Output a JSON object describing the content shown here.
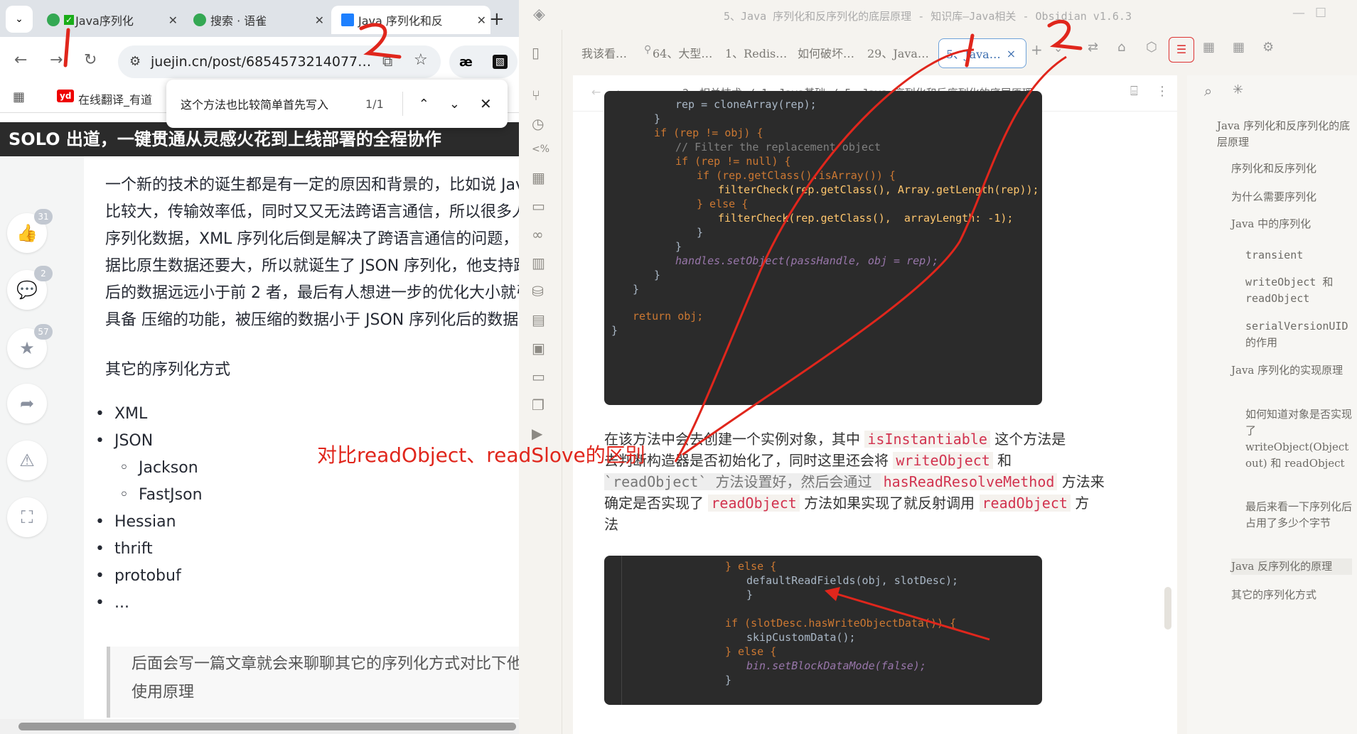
{
  "chrome": {
    "tabs": [
      {
        "label": "Java序列化",
        "favicon_color": "#34a853"
      },
      {
        "label": "搜索 · 语雀",
        "favicon_color": "#34a853"
      },
      {
        "label": "Java 序列化和反",
        "favicon_color": "#1e80ff"
      }
    ],
    "close_glyph": "✕",
    "new_tab_glyph": "+",
    "url": "juejin.cn/post/6854573214077…",
    "bookmark": "在线翻译_有道",
    "find": {
      "query": "这个方法也比较简单首先写入",
      "count": "1/1"
    },
    "page_banner": "SOLO 出道，一键贯通从灵感火花到上线部署的全程协作",
    "rail_badges": {
      "like": "31",
      "comment": "2",
      "star": "57"
    },
    "article_lines": [
      "一个新的技术的诞生都是有一定的原因和背景的，比如说 Jav",
      "比较大，传输效率低，同时又又无法跨语言通信，所以很多人",
      "序列化数据，XML 序列化后倒是解决了跨语言通信的问题，但",
      "据比原生数据还要大，所以就诞生了 JSON 序列化，他支持跨",
      "后的数据远远小于前 2 者，最后有人想进一步的优化大小就引",
      "具备 压缩的功能，被压缩的数据小于 JSON 序列化后的数据。"
    ],
    "other_heading": "其它的序列化方式",
    "list": [
      "XML",
      "JSON",
      "Hessian",
      "thrift",
      "protobuf",
      "..."
    ],
    "sublist": [
      "Jackson",
      "FastJson"
    ],
    "quote_lines": [
      "后面会写一篇文章就会来聊聊其它的序列化方式对比下他们",
      "使用原理"
    ]
  },
  "obsidian": {
    "title": "5、Java 序列化和反序列化的底层原理 - 知识库—Java相关 - Obsidian v1.6.3",
    "tabs": [
      "我该看…",
      "64、大型…",
      "1、Redis…",
      "如何破坏…",
      "29、Java…",
      "5、Java…"
    ],
    "breadcrumb": [
      "2、相关技术",
      "1、Java基础",
      "5、Java 序列化和反序列化的底层原理"
    ],
    "code1": [
      "rep = cloneArray(rep);",
      "}",
      "if (rep != obj) {",
      "// Filter the replacement object",
      "if (rep != null) {",
      "if (rep.getClass().isArray()) {",
      "filterCheck(rep.getClass(), Array.getLength(rep));",
      "} else {",
      "filterCheck(rep.getClass(),  arrayLength: -1);",
      "}",
      "}",
      "handles.setObject(passHandle, obj = rep);",
      "}",
      "}",
      "return obj;",
      "}"
    ],
    "body_lines": [
      [
        "在该方法中会去创建一个实例对象，其中 ",
        "isInstantiable",
        " 这个方法是"
      ],
      [
        "去判断构造器是否初始化了，同时这里还会将 ",
        "writeObject",
        " 和"
      ],
      [
        "`readObject` 方法设置好，然后会通过 ",
        "hasReadResolveMethod",
        " 方法来"
      ],
      [
        "确定是否实现了 ",
        "readObject",
        " 方法如果实现了就反射调用 ",
        "readObject",
        " 方"
      ],
      [
        "法"
      ]
    ],
    "code2": [
      "} else {",
      "defaultReadFields(obj, slotDesc);",
      "}",
      "",
      "if (slotDesc.hasWriteObjectData()) {",
      "skipCustomData();",
      "} else {",
      "bin.setBlockDataMode(false);",
      "}"
    ],
    "outline": [
      "Java 序列化和反序列化的底层原理",
      "序列化和反序列化",
      "为什么需要序列化",
      "Java 中的序列化",
      "transient",
      "writeObject 和 readObject",
      "serialVersionUID 的作用",
      "Java 序列化的实现原理",
      "如何知道对象是否实现了 writeObject(Object out) 和 readObject",
      "最后来看一下序列化后占用了多少个字节",
      "Java 反序列化的原理",
      "其它的序列化方式"
    ]
  },
  "annotation": {
    "text": "对比readObject、readSlove的区别",
    "marks": [
      "1",
      "2",
      "1",
      "2"
    ],
    "color": "#e0261c"
  }
}
